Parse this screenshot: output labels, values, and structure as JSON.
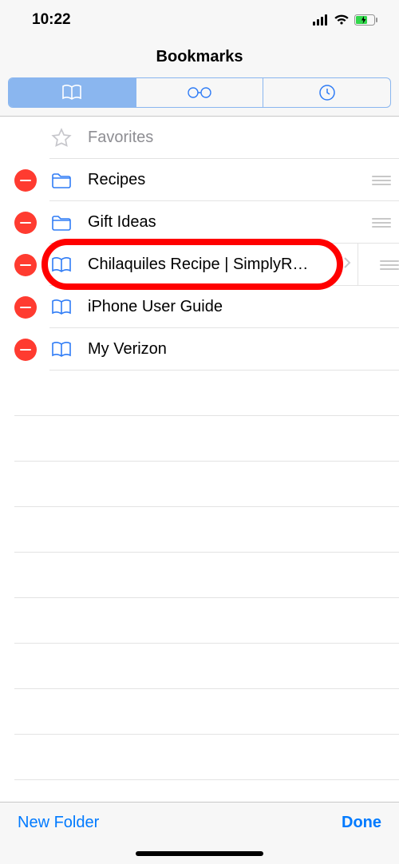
{
  "status": {
    "time": "10:22"
  },
  "header": {
    "title": "Bookmarks"
  },
  "tabs": {
    "selected_index": 0,
    "items": [
      "bookmarks",
      "reading_list",
      "history"
    ]
  },
  "rows": [
    {
      "label": "Favorites",
      "type": "favorites",
      "deletable": false,
      "reorderable": false
    },
    {
      "label": "Recipes",
      "type": "folder",
      "deletable": true,
      "reorderable": true
    },
    {
      "label": "Gift Ideas",
      "type": "folder",
      "deletable": true,
      "reorderable": true
    },
    {
      "label": "Chilaquiles Recipe | SimplyRe...",
      "type": "bookmark",
      "deletable": true,
      "reorderable": true,
      "highlighted": true
    },
    {
      "label": "iPhone User Guide",
      "type": "bookmark",
      "deletable": true,
      "reorderable": false
    },
    {
      "label": "My Verizon",
      "type": "bookmark",
      "deletable": true,
      "reorderable": false
    }
  ],
  "toolbar": {
    "new_folder_label": "New Folder",
    "done_label": "Done"
  }
}
